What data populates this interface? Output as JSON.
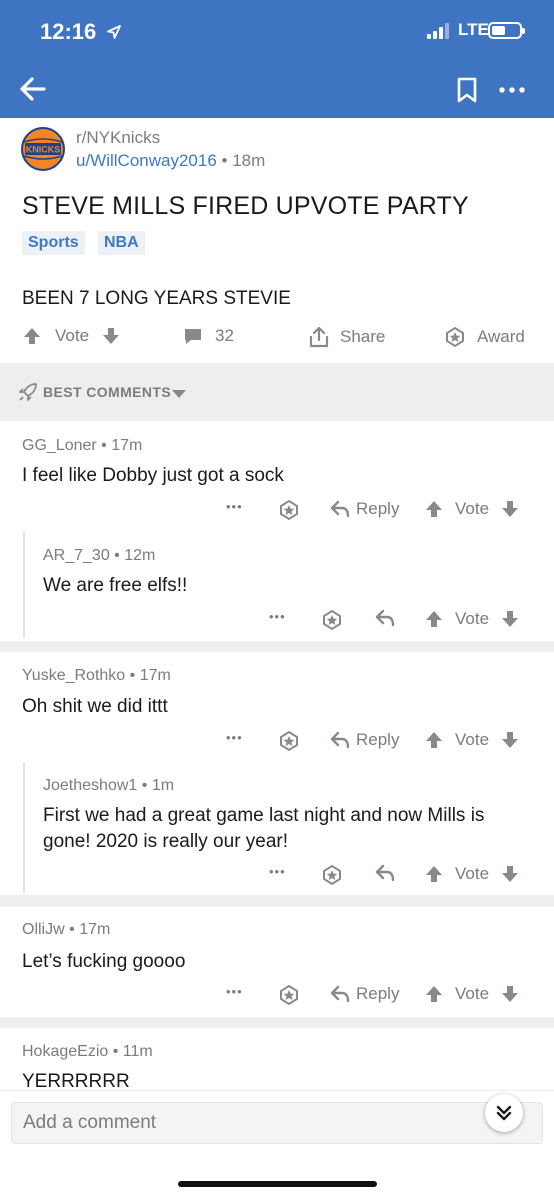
{
  "status_bar": {
    "time": "12:16",
    "location_icon": "location-arrow-icon",
    "network": "LTE",
    "signal_icon": "signal-bars-icon",
    "battery_icon": "battery-icon"
  },
  "nav": {
    "back_icon": "back-arrow-icon",
    "save_icon": "bookmark-icon",
    "more_icon": "more-dots-icon"
  },
  "colors": {
    "brand_blue": "#3f74c3",
    "link_blue": "#3c79c6",
    "meta_gray": "#7c7c7c",
    "separator": "#eeeeee"
  },
  "post": {
    "subreddit": "r/NYKnicks",
    "author": "u/WillConway2016",
    "dot": "•",
    "age": "18m",
    "subreddit_logo_text": "KNICKS",
    "title": "STEVE MILLS FIRED UPVOTE PARTY",
    "flairs": [
      "Sports",
      "NBA"
    ],
    "body": "BEEN 7 LONG YEARS STEVIE",
    "vote_label": "Vote",
    "comment_count": "32",
    "share_label": "Share",
    "award_label": "Award"
  },
  "sort": {
    "label": "BEST COMMENTS"
  },
  "actions": {
    "more": "•••",
    "reply": "Reply",
    "vote": "Vote"
  },
  "comments": [
    {
      "user": "GG_Loner",
      "age": "17m",
      "text": "I feel like Dobby just got a sock"
    },
    {
      "user": "AR_7_30",
      "age": "12m",
      "text": "We are free elfs!!"
    },
    {
      "user": "Yuske_Rothko",
      "age": "17m",
      "text": "Oh shit we did ittt"
    },
    {
      "user": "Joetheshow1",
      "age": "1m",
      "text": "First we had a great game last night and now Mills is gone! 2020 is really our year!"
    },
    {
      "user": "OlliJw",
      "age": "17m",
      "text": "Let’s fucking goooo"
    },
    {
      "user": "HokageEzio",
      "age": "11m",
      "text": "YERRRRRR"
    }
  ],
  "composer": {
    "placeholder": "Add a comment",
    "collapse_icon": "double-chevron-down-icon"
  }
}
